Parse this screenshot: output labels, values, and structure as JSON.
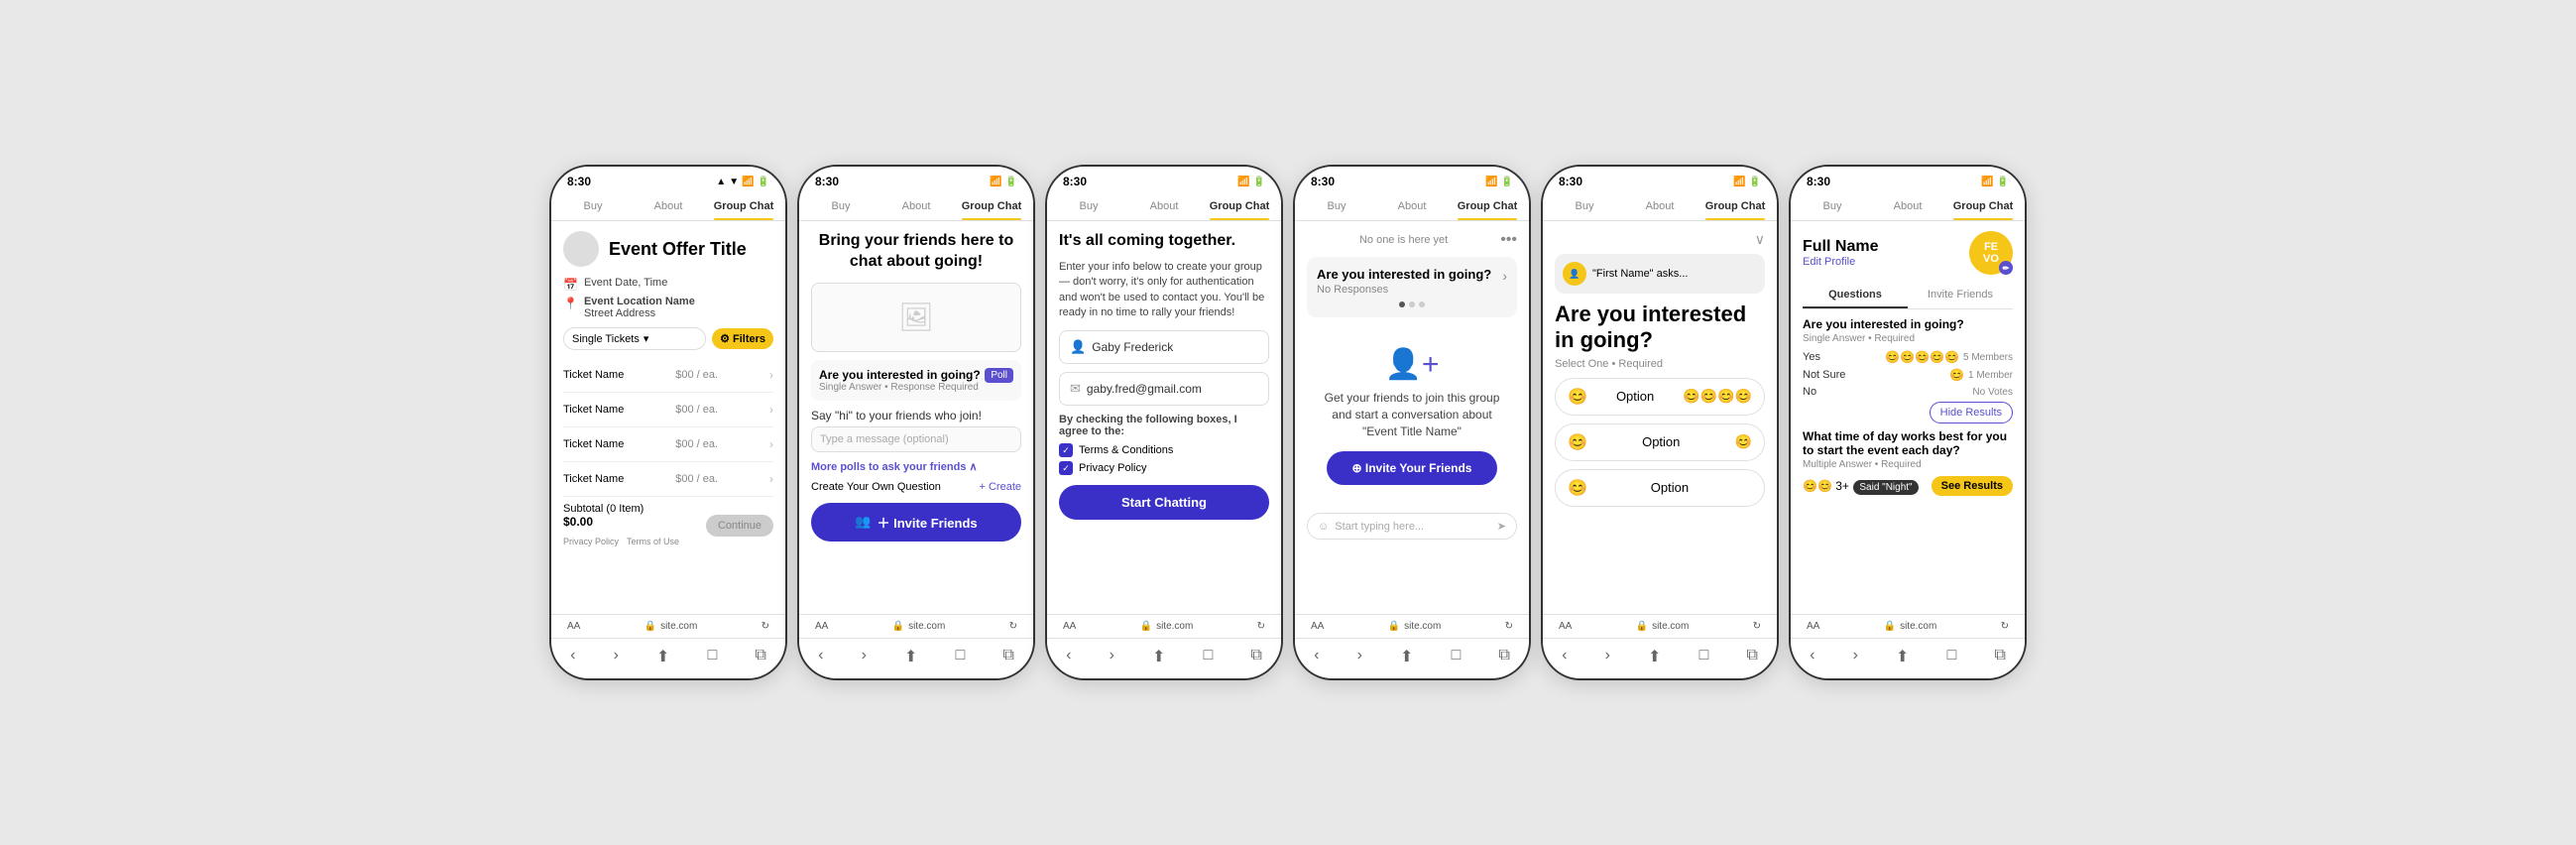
{
  "phones": [
    {
      "id": "phone1",
      "statusBar": {
        "time": "8:30",
        "icons": "▲ ▼ ⬛"
      },
      "tabs": [
        "Buy",
        "About",
        "Group Chat"
      ],
      "activeTab": "Buy",
      "content": {
        "eventTitle": "Event Offer Title",
        "eventDate": "Event Date, Time",
        "eventLocation": "Event Location Name",
        "streetAddress": "Street Address",
        "ticketType": "Single Tickets",
        "filterLabel": "Filters",
        "tickets": [
          {
            "name": "Ticket Name",
            "price": "$00 / ea."
          },
          {
            "name": "Ticket Name",
            "price": "$00 / ea."
          },
          {
            "name": "Ticket Name",
            "price": "$00 / ea."
          },
          {
            "name": "Ticket Name",
            "price": "$00 / ea."
          }
        ],
        "subtotal": "Subtotal (0 Item)",
        "amount": "$0.00",
        "continueLabel": "Continue",
        "privacyLabel": "Privacy Policy",
        "termsLabel": "Terms of Use"
      },
      "bottomBar": {
        "site": "site.com"
      },
      "navIcons": [
        "‹",
        "›",
        "⬆",
        "□",
        "⧉"
      ]
    },
    {
      "id": "phone2",
      "statusBar": {
        "time": "8:30"
      },
      "tabs": [
        "Buy",
        "About",
        "Group Chat"
      ],
      "activeTab": "Group Chat",
      "content": {
        "heading": "Bring your friends here to chat about going!",
        "pollTitle": "Are you interested in going?",
        "pollSub": "Single Answer • Response Required",
        "pollBadge": "Poll",
        "sayHi": "Say \"hi\" to your friends who join!",
        "messagePlaceholder": "Type a message (optional)",
        "morePolls": "More polls to ask your friends ∧",
        "createLabel": "Create Your Own Question",
        "createLink": "+ Create",
        "inviteLabel": "＋ Invite Friends"
      },
      "bottomBar": {
        "site": "site.com"
      },
      "navIcons": [
        "‹",
        "›",
        "⬆",
        "□",
        "⧉"
      ]
    },
    {
      "id": "phone3",
      "statusBar": {
        "time": "8:30"
      },
      "tabs": [
        "Buy",
        "About",
        "Group Chat"
      ],
      "activeTab": "Group Chat",
      "content": {
        "heading": "It's all coming together.",
        "description": "Enter your info below to create your group — don't worry, it's only for authentication and won't be used to contact you. You'll be ready in no time to rally your friends!",
        "nameValue": "Gaby Frederick",
        "emailValue": "gaby.fred@gmail.com",
        "agreeTitle": "By checking the following boxes, I agree to the:",
        "terms": "Terms & Conditions",
        "privacy": "Privacy Policy",
        "startChatLabel": "Start Chatting"
      },
      "bottomBar": {
        "site": "site.com"
      },
      "navIcons": [
        "‹",
        "›",
        "⬆",
        "□",
        "⧉"
      ]
    },
    {
      "id": "phone4",
      "statusBar": {
        "time": "8:30"
      },
      "tabs": [
        "Buy",
        "About",
        "Group Chat"
      ],
      "activeTab": "Group Chat",
      "content": {
        "noOne": "No one is here yet",
        "pollTitle": "Are you interested in going?",
        "pollAnswer": "No Responses",
        "emptyText": "Get your friends to join this group and start a conversation about \"Event Title Name\"",
        "inviteLabel": "⊕ Invite Your Friends",
        "inputPlaceholder": "Start typing here..."
      },
      "bottomBar": {
        "site": "site.com"
      },
      "navIcons": [
        "‹",
        "›",
        "⬆",
        "□",
        "⧉"
      ]
    },
    {
      "id": "phone5",
      "statusBar": {
        "time": "8:30"
      },
      "tabs": [
        "Buy",
        "About",
        "Group Chat"
      ],
      "activeTab": "Group Chat",
      "content": {
        "chatBubble": "\"First Name\" asks...",
        "bigQuestion": "Are you interested in going?",
        "selectLabel": "Select One • Required",
        "options": [
          "Option",
          "Option",
          "Option"
        ]
      },
      "bottomBar": {
        "site": "site.com"
      },
      "navIcons": [
        "‹",
        "›",
        "⬆",
        "□",
        "⧉"
      ]
    },
    {
      "id": "phone6",
      "statusBar": {
        "time": "8:30"
      },
      "tabs": [
        "Buy",
        "About",
        "Group Chat"
      ],
      "activeTab": "Group Chat",
      "content": {
        "fullName": "Full Name",
        "editProfile": "Edit Profile",
        "avatarText": "FE\nVO",
        "tabs2": [
          "Questions",
          "Invite Friends"
        ],
        "activeTab2": "Questions",
        "q1Title": "Are you interested in going?",
        "q1Sub": "Single Answer • Required",
        "answers1": [
          {
            "label": "Yes",
            "count": "5 Members",
            "emojis": "😊😊😊😊😊"
          },
          {
            "label": "Not Sure",
            "count": "1 Member",
            "emojis": "😊"
          },
          {
            "label": "No",
            "count": "No Votes",
            "emojis": ""
          }
        ],
        "hideResults": "Hide Results",
        "q2Title": "What time of day works best for you to start the event each day?",
        "q2Sub": "Multiple Answer • Required",
        "q2Said": "Said \"Night\"",
        "seeResults": "See Results",
        "nightEmojis": "😊😊 3+"
      },
      "bottomBar": {
        "site": "site.com"
      },
      "navIcons": [
        "‹",
        "›",
        "⬆",
        "□",
        "⧉"
      ]
    }
  ]
}
